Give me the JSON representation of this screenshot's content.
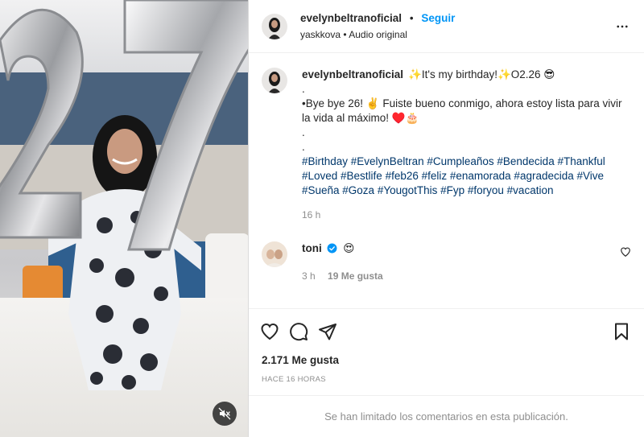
{
  "header": {
    "username": "evelynbeltranoficial",
    "separator": "•",
    "follow_label": "Seguir",
    "audio_line": "yaskkova • Audio original"
  },
  "caption": {
    "username": "evelynbeltranoficial",
    "line1": "✨It's my birthday!✨O2.26 😎",
    "line2": ".",
    "line3": "•Bye bye 26! ✌️ Fuiste bueno conmigo, ahora estoy lista para vivir la vida al máximo! ♥️🎂",
    "line4": ".",
    "line5": ".",
    "hashtags": "#Birthday #EvelynBeltran #Cumpleaños #Bendecida #Thankful #Loved #Bestlife #feb26 #feliz #enamorada #agradecida #Vive #Sueña #Goza #YougotThis #Fyp #foryou #vacation",
    "time": "16 h"
  },
  "comment": {
    "username": "toni",
    "text": "😍",
    "time": "3 h",
    "likes": "19 Me gusta"
  },
  "likes_count": "2.171 Me gusta",
  "timestamp": "HACE 16 HORAS",
  "limited_notice": "Se han limitado los comentarios en esta publicación.",
  "icons": {
    "like": "heart-icon",
    "comment": "comment-icon",
    "share": "paper-plane-icon",
    "save": "bookmark-icon",
    "more": "more-options-icon",
    "mute": "speaker-muted-icon",
    "verified": "verified-badge-icon"
  },
  "colors": {
    "link_blue": "#0095f6",
    "hashtag": "#00376b",
    "muted_text": "#8e8e8e",
    "verified": "#0095f6"
  }
}
